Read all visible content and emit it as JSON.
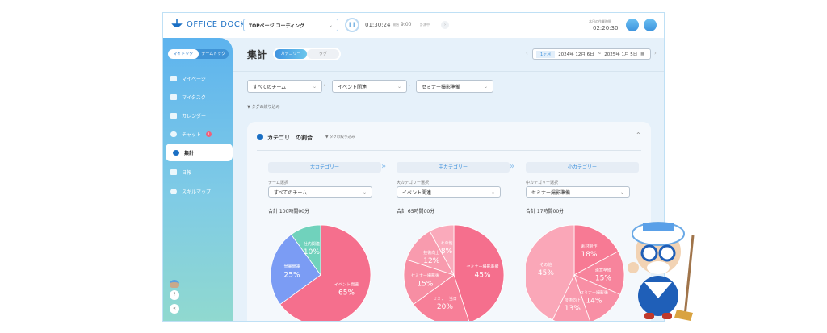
{
  "header": {
    "logo": "OFFICE DOCK",
    "task": "TOPページ コーディング",
    "timer": "01:30:24",
    "start_label": "開始",
    "start_time": "9:00",
    "status": "計測中",
    "today_label": "本日の作業時間",
    "today_time": "02:20:30"
  },
  "sidebar": {
    "toggle": [
      "マイドック",
      "チームドック"
    ],
    "items": [
      {
        "label": "マイページ"
      },
      {
        "label": "マイタスク"
      },
      {
        "label": "カレンダー"
      },
      {
        "label": "チャット",
        "badge": "1"
      },
      {
        "label": "集計"
      },
      {
        "label": "日報"
      },
      {
        "label": "スキルマップ"
      }
    ],
    "help": "?",
    "collapse": "«"
  },
  "main": {
    "title": "集計",
    "tabs": [
      "カテゴリー",
      "タグ"
    ],
    "range": "1ヶ月",
    "date_from": "2024年 12月 6日",
    "sep": "~",
    "date_to": "2025年 1月 5日",
    "filters": [
      "すべてのチーム",
      "イベント関連",
      "セミナー撮影準備"
    ],
    "tag_filter": "タグの絞り込み"
  },
  "card": {
    "title": "カテゴリ　の割合",
    "tag_filter": "タグの絞り込み"
  },
  "colors": {
    "pink": "#f46d8b",
    "blue": "#7b9cf4",
    "teal": "#70d2bc"
  },
  "chart_data": [
    {
      "type": "pie",
      "header": "大カテゴリー",
      "select_label": "チーム選択",
      "select_value": "すべてのチーム",
      "total": "合計 100時間00分",
      "labels": [
        "イベント関連",
        "営業関連",
        "社内関連"
      ],
      "values": [
        65,
        25,
        10
      ],
      "colors": [
        "#f56f8d",
        "#7b9cf4",
        "#70d2bc"
      ]
    },
    {
      "type": "pie",
      "header": "中カテゴリー",
      "select_label": "大カテゴリー選択",
      "select_value": "イベント関連",
      "total": "合計 65時間00分",
      "labels": [
        "セミナー撮影準備",
        "セミナー当日",
        "セミナー撮影後",
        "技術向上",
        "その他"
      ],
      "values": [
        45,
        20,
        15,
        12,
        8
      ],
      "colors": [
        "#f56f8d",
        "#f77f98",
        "#f78ea3",
        "#f89bae",
        "#faaabb"
      ]
    },
    {
      "type": "pie",
      "header": "小カテゴリー",
      "select_label": "中カテゴリー選択",
      "select_value": "セミナー撮影準備",
      "total": "合計 17時間00分",
      "labels": [
        "素材制作",
        "運営準備",
        "セミナー撮影後",
        "技術向上",
        "その他"
      ],
      "values": [
        18,
        15,
        14,
        13,
        45
      ],
      "colors": [
        "#f77a94",
        "#f7849c",
        "#f88fa5",
        "#f99aae",
        "#faa7b8"
      ]
    }
  ]
}
